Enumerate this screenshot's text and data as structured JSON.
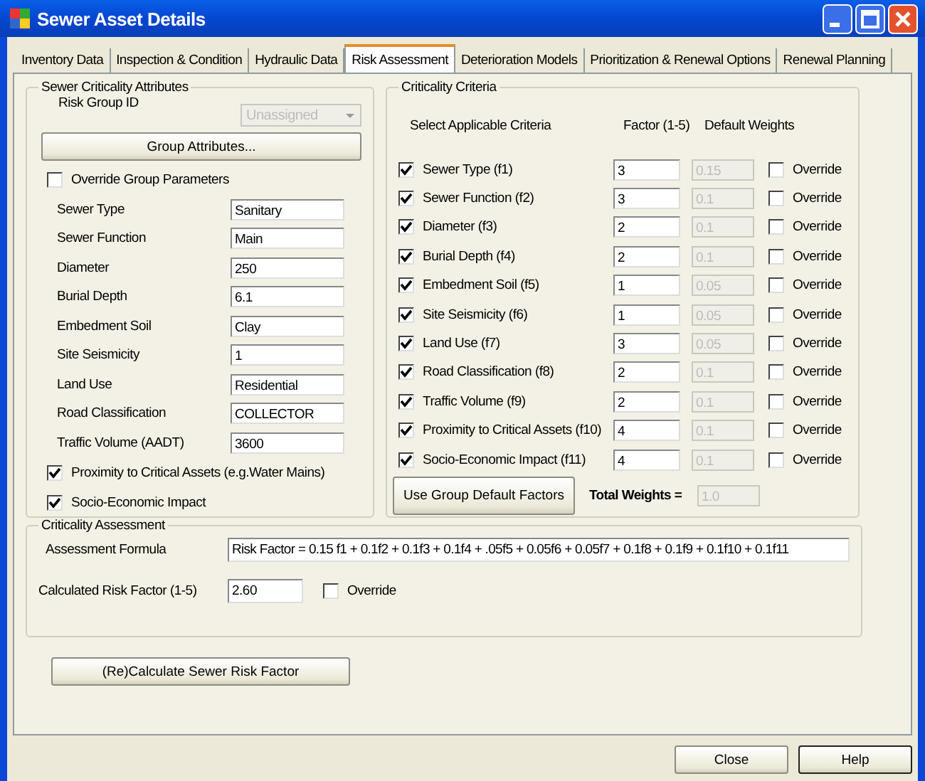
{
  "window": {
    "title": "Sewer Asset Details"
  },
  "tabs": [
    {
      "label": "Inventory Data",
      "selected": false
    },
    {
      "label": "Inspection & Condition",
      "selected": false
    },
    {
      "label": "Hydraulic Data",
      "selected": false
    },
    {
      "label": "Risk Assessment",
      "selected": true
    },
    {
      "label": "Deterioration Models",
      "selected": false
    },
    {
      "label": "Prioritization & Renewal Options",
      "selected": false
    },
    {
      "label": "Renewal Planning",
      "selected": false
    }
  ],
  "attributes": {
    "title": "Sewer Criticality Attributes",
    "risk_group": {
      "label": "Risk Group ID",
      "value": "Unassigned",
      "disabled": true
    },
    "group_button": "Group Attributes...",
    "override": {
      "label": "Override Group Parameters",
      "checked": false
    },
    "fields": [
      {
        "label": "Sewer Type",
        "value": "Sanitary"
      },
      {
        "label": "Sewer Function",
        "value": "Main"
      },
      {
        "label": "Diameter",
        "value": "250"
      },
      {
        "label": "Burial Depth",
        "value": "6.1"
      },
      {
        "label": "Embedment Soil",
        "value": "Clay"
      },
      {
        "label": "Site Seismicity",
        "value": "1"
      },
      {
        "label": "Land Use",
        "value": "Residential"
      },
      {
        "label": "Road Classification",
        "value": "COLLECTOR"
      },
      {
        "label": "Traffic Volume (AADT)",
        "value": "3600"
      }
    ],
    "checks": [
      {
        "label": "Proximity to Critical Assets (e.g.Water Mains)",
        "checked": true
      },
      {
        "label": "Socio-Economic Impact",
        "checked": true
      }
    ]
  },
  "criteria": {
    "title": "Criticality Criteria",
    "headers": [
      "Select Applicable Criteria",
      "Factor (1-5)",
      "Default Weights"
    ],
    "weights_disabled": true,
    "rows": [
      {
        "label": "Sewer Type (f1)",
        "checked": true,
        "factor": "3",
        "weight": "0.15",
        "override_label": "Override",
        "override": false
      },
      {
        "label": "Sewer Function (f2)",
        "checked": true,
        "factor": "3",
        "weight": "0.1",
        "override_label": "Override",
        "override": false
      },
      {
        "label": "Diameter (f3)",
        "checked": true,
        "factor": "2",
        "weight": "0.1",
        "override_label": "Override",
        "override": false
      },
      {
        "label": "Burial Depth (f4)",
        "checked": true,
        "factor": "2",
        "weight": "0.1",
        "override_label": "Override",
        "override": false
      },
      {
        "label": "Embedment Soil (f5)",
        "checked": true,
        "factor": "1",
        "weight": "0.05",
        "override_label": "Override",
        "override": false
      },
      {
        "label": "Site Seismicity (f6)",
        "checked": true,
        "factor": "1",
        "weight": "0.05",
        "override_label": "Override",
        "override": false
      },
      {
        "label": "Land Use (f7)",
        "checked": true,
        "factor": "3",
        "weight": "0.05",
        "override_label": "Override",
        "override": false
      },
      {
        "label": "Road Classification (f8)",
        "checked": true,
        "factor": "2",
        "weight": "0.1",
        "override_label": "Override",
        "override": false
      },
      {
        "label": "Traffic Volume (f9)",
        "checked": true,
        "factor": "2",
        "weight": "0.1",
        "override_label": "Override",
        "override": false
      },
      {
        "label": "Proximity to Critical Assets (f10)",
        "checked": true,
        "factor": "4",
        "weight": "0.1",
        "override_label": "Override",
        "override": false
      },
      {
        "label": "Socio-Economic Impact (f11)",
        "checked": true,
        "factor": "4",
        "weight": "0.1",
        "override_label": "Override",
        "override": false
      }
    ],
    "default_button": "Use Group Default Factors",
    "total_label": "Total Weights =",
    "total_value": "1.0"
  },
  "assessment": {
    "title": "Criticality Assessment",
    "formula_label": "Assessment Formula",
    "formula": "Risk Factor = 0.15 f1 + 0.1f2 + 0.1f3 + 0.1f4 + .05f5 + 0.05f6 + 0.05f7 + 0.1f8 + 0.1f9 + 0.1f10 + 0.1f11",
    "risk_label": "Calculated Risk Factor (1-5)",
    "risk_value": "2.60",
    "override": {
      "label": "Override",
      "checked": false
    }
  },
  "recalc_button": "(Re)Calculate Sewer Risk Factor",
  "buttons": [
    "Close",
    "Help"
  ]
}
